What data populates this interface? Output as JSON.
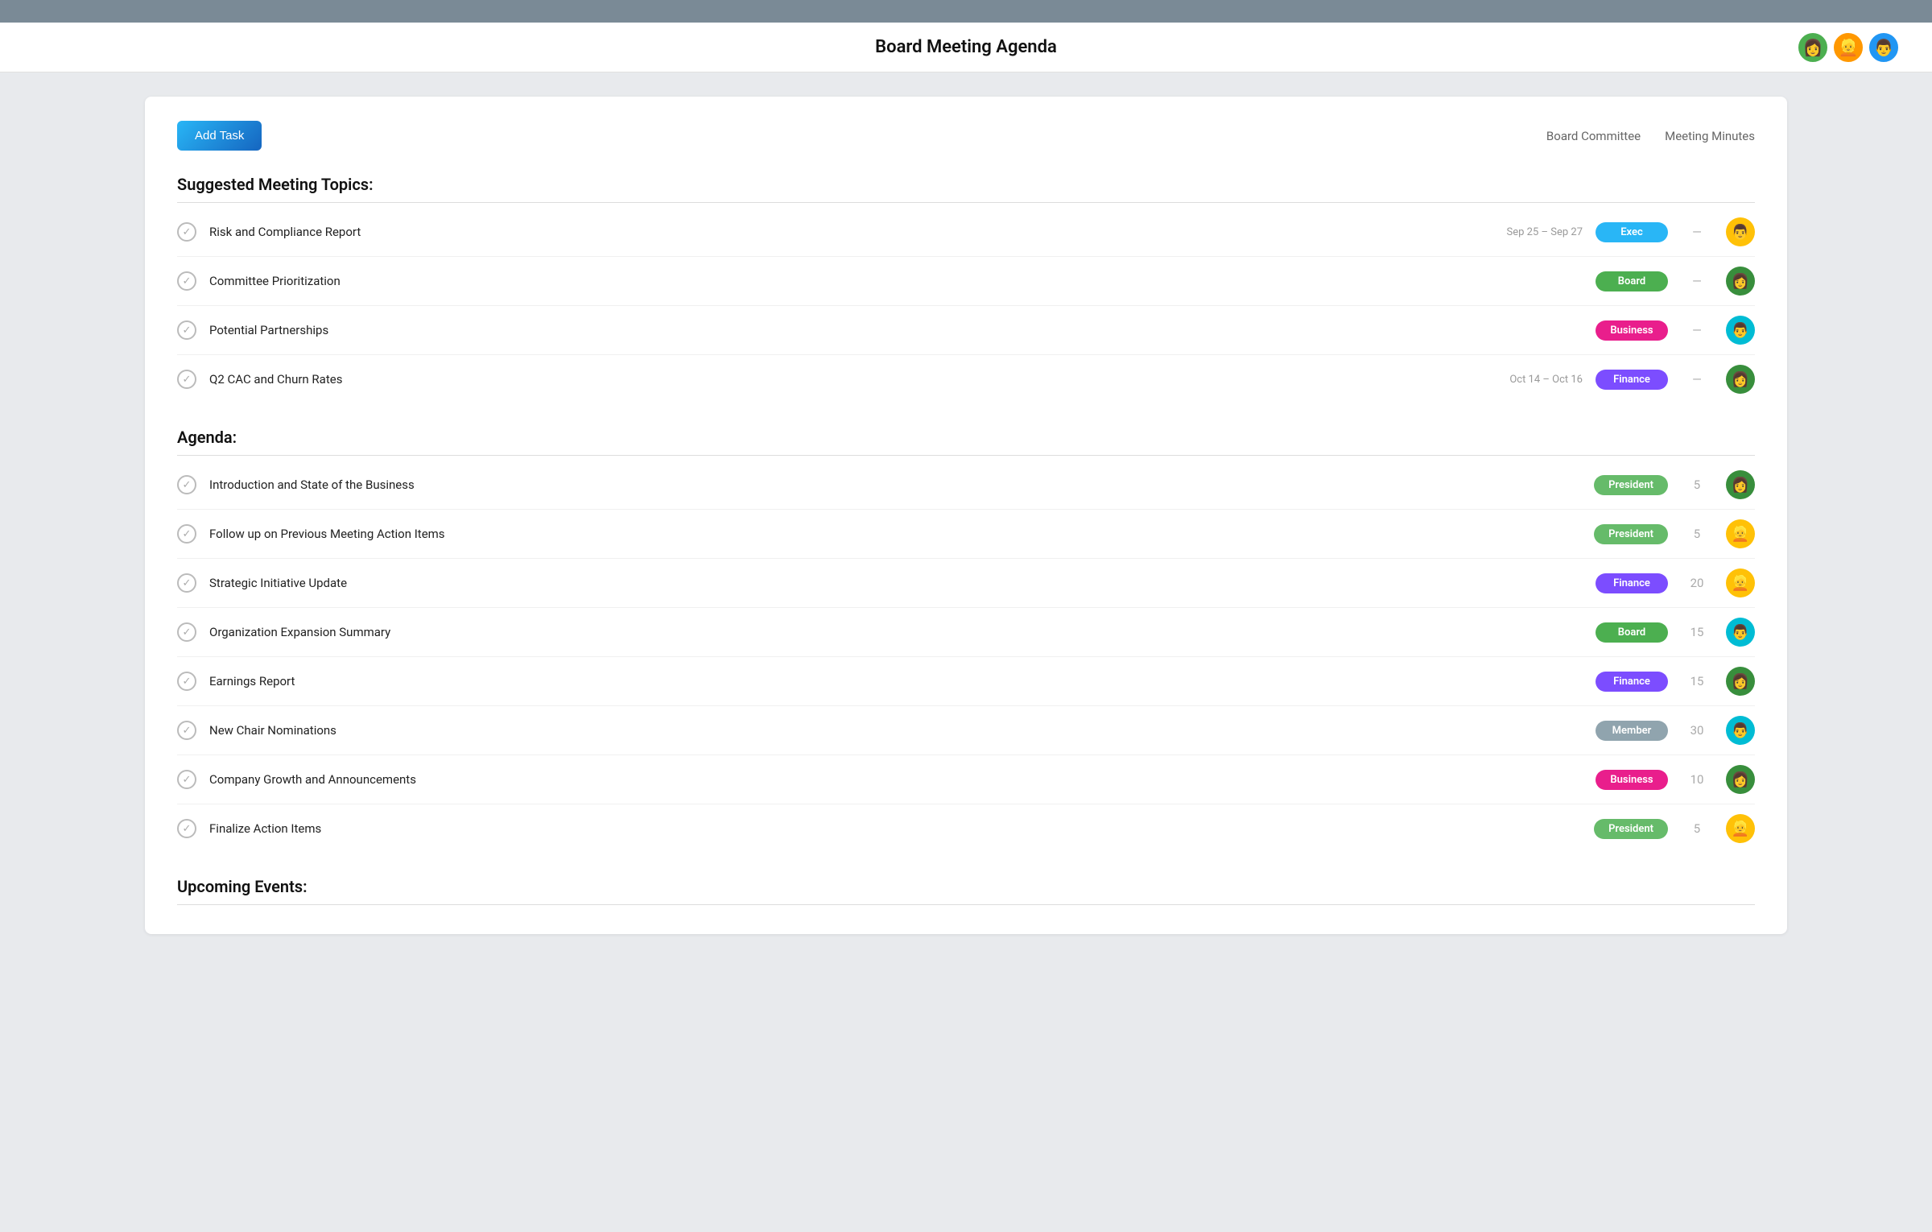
{
  "topbar": {},
  "header": {
    "title": "Board Meeting Agenda",
    "avatars": [
      {
        "id": "av1",
        "emoji": "👩",
        "bg": "#4caf50"
      },
      {
        "id": "av2",
        "emoji": "👱",
        "bg": "#ff9800"
      },
      {
        "id": "av3",
        "emoji": "👨",
        "bg": "#2196f3"
      }
    ]
  },
  "toolbar": {
    "add_task_label": "Add Task",
    "link1": "Board Committee",
    "link2": "Meeting Minutes"
  },
  "suggested_section": {
    "title": "Suggested Meeting Topics:",
    "items": [
      {
        "label": "Risk and Compliance Report",
        "date": "Sep 25 – Sep 27",
        "badge": "Exec",
        "badge_class": "badge-exec",
        "minutes": "—",
        "avatar_emoji": "👨",
        "avatar_class": "av-yellow"
      },
      {
        "label": "Committee Prioritization",
        "date": "",
        "badge": "Board",
        "badge_class": "badge-board",
        "minutes": "—",
        "avatar_emoji": "👩",
        "avatar_class": "av-darkgreen"
      },
      {
        "label": "Potential Partnerships",
        "date": "",
        "badge": "Business",
        "badge_class": "badge-business",
        "minutes": "—",
        "avatar_emoji": "👨",
        "avatar_class": "av-cyan"
      },
      {
        "label": "Q2 CAC and Churn Rates",
        "date": "Oct 14 – Oct 16",
        "badge": "Finance",
        "badge_class": "badge-finance",
        "minutes": "—",
        "avatar_emoji": "👩",
        "avatar_class": "av-darkgreen"
      }
    ]
  },
  "agenda_section": {
    "title": "Agenda:",
    "items": [
      {
        "label": "Introduction and State of the Business",
        "date": "",
        "badge": "President",
        "badge_class": "badge-president",
        "minutes": "5",
        "avatar_emoji": "👩",
        "avatar_class": "av-darkgreen"
      },
      {
        "label": "Follow up on Previous Meeting Action Items",
        "date": "",
        "badge": "President",
        "badge_class": "badge-president",
        "minutes": "5",
        "avatar_emoji": "👱",
        "avatar_class": "av-yellow"
      },
      {
        "label": "Strategic Initiative Update",
        "date": "",
        "badge": "Finance",
        "badge_class": "badge-finance",
        "minutes": "20",
        "avatar_emoji": "👱",
        "avatar_class": "av-yellow"
      },
      {
        "label": "Organization Expansion Summary",
        "date": "",
        "badge": "Board",
        "badge_class": "badge-board",
        "minutes": "15",
        "avatar_emoji": "👨",
        "avatar_class": "av-cyan"
      },
      {
        "label": "Earnings Report",
        "date": "",
        "badge": "Finance",
        "badge_class": "badge-finance",
        "minutes": "15",
        "avatar_emoji": "👩",
        "avatar_class": "av-darkgreen"
      },
      {
        "label": "New Chair Nominations",
        "date": "",
        "badge": "Member",
        "badge_class": "badge-member",
        "minutes": "30",
        "avatar_emoji": "👨",
        "avatar_class": "av-cyan"
      },
      {
        "label": "Company Growth and Announcements",
        "date": "",
        "badge": "Business",
        "badge_class": "badge-business",
        "minutes": "10",
        "avatar_emoji": "👩",
        "avatar_class": "av-darkgreen"
      },
      {
        "label": "Finalize Action Items",
        "date": "",
        "badge": "President",
        "badge_class": "badge-president",
        "minutes": "5",
        "avatar_emoji": "👱",
        "avatar_class": "av-yellow"
      }
    ]
  },
  "upcoming_section": {
    "title": "Upcoming Events:"
  }
}
